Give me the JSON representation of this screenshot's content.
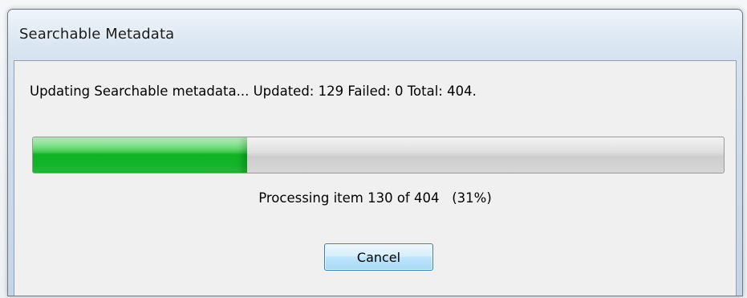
{
  "window": {
    "title": "Searchable Metadata"
  },
  "status": {
    "text": "Updating Searchable metadata... Updated: 129  Failed: 0  Total: 404."
  },
  "progress": {
    "fraction": 0.31,
    "fill_color": "#13b52a",
    "text": "Processing item 130 of 404   (31%)"
  },
  "buttons": {
    "cancel_label": "Cancel"
  }
}
